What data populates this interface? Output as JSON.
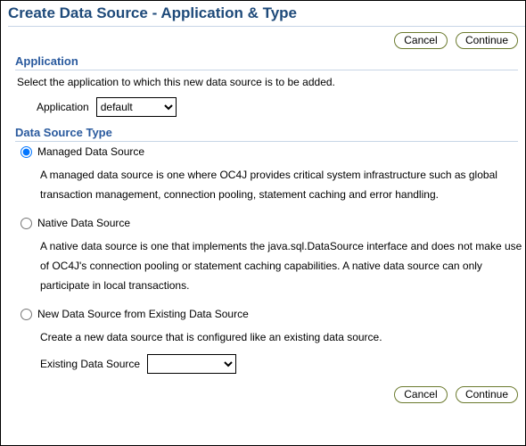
{
  "page": {
    "title": "Create Data Source - Application & Type"
  },
  "buttons": {
    "cancel": "Cancel",
    "continue": "Continue"
  },
  "application_section": {
    "heading": "Application",
    "hint": "Select the application to which this new data source is to be added.",
    "field_label": "Application",
    "selected": "default",
    "options": [
      "default"
    ]
  },
  "type_section": {
    "heading": "Data Source Type",
    "selected_index": 0,
    "options": [
      {
        "label": "Managed Data Source",
        "desc": "A managed data source is one where OC4J provides critical system infrastructure such as global transaction management, connection pooling, statement caching and error handling."
      },
      {
        "label": "Native Data Source",
        "desc": "A native data source is one that implements the java.sql.DataSource interface and does not make use of OC4J's connection pooling or statement caching capabilities. A native data source can only participate in local transactions."
      },
      {
        "label": "New Data Source from Existing Data Source",
        "desc": "Create a new data source that is configured like an existing data source.",
        "subfield_label": "Existing Data Source",
        "subfield_selected": ""
      }
    ]
  }
}
